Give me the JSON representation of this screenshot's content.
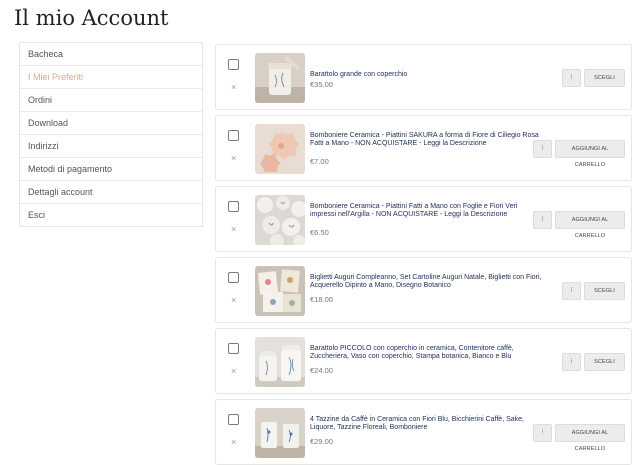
{
  "page": {
    "title": "Il mio Account"
  },
  "nav": {
    "items": [
      {
        "label": "Bacheca"
      },
      {
        "label": "I Miei Preferiti"
      },
      {
        "label": "Ordini"
      },
      {
        "label": "Download"
      },
      {
        "label": "Indirizzi"
      },
      {
        "label": "Metodi di pagamento"
      },
      {
        "label": "Dettagli account"
      },
      {
        "label": "Esci"
      }
    ],
    "active_index": 1
  },
  "wishlist": {
    "remove_symbol": "×",
    "qty_symbol": "⁝",
    "items": [
      {
        "title": "Barattolo grande con coperchio",
        "price": "€35.00",
        "action": "SCEGLI"
      },
      {
        "title": "Bomboniere Ceramica - Piattini SAKURA a forma di Fiore di Ciliegio Rosa Fatti a Mano - NON ACQUISTARE - Leggi la Descrizione",
        "price": "€7.00",
        "action": "AGGIUNGI AL CARRELLO"
      },
      {
        "title": "Bomboniere Ceramica - Piattini Fatti a Mano con Foglie e Fiori Veri impressi nell'Argilla - NON ACQUISTARE - Leggi la Descrizione",
        "price": "€6.50",
        "action": "AGGIUNGI AL CARRELLO"
      },
      {
        "title": "Biglietti Auguri Compleanno, Set Cartoline Auguri Natale, Biglietti con Fiori, Acquerello Dipinto a Mano, Disegno Botanico",
        "price": "€18.00",
        "action": "SCEGLI"
      },
      {
        "title": "Barattolo PICCOLO con coperchio in ceramica, Contenitore caffè, Zuccheriera, Vaso con coperchio, Stampa botanica, Bianco e Blu",
        "price": "€24.00",
        "action": "SCEGLI"
      },
      {
        "title": "4 Tazzine da Caffè in Ceramica con Fiori Blu, Bicchierini Caffè, Sake, Liquore, Tazzine Floreali, Bomboniere",
        "price": "€29.00",
        "action": "AGGIUNGI AL CARRELLO"
      }
    ]
  }
}
